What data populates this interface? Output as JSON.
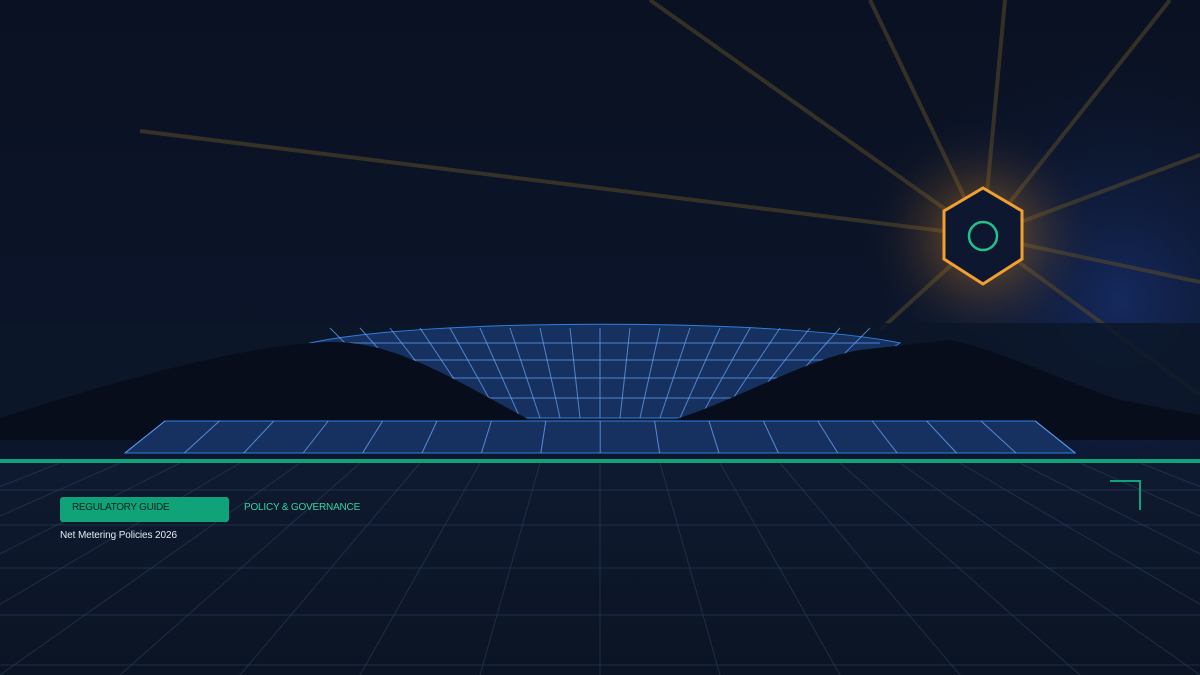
{
  "header": {
    "badge_label": "REGULATORY GUIDE",
    "category_label": "POLICY & GOVERNANCE",
    "subtitle": "Net Metering Policies 2026"
  },
  "icons": {
    "sun": "hexagon-sun-icon",
    "corner": "corner-bracket-icon"
  },
  "colors": {
    "background": "#0b1224",
    "accent": "#10a37a",
    "accent_text": "#34d3a0",
    "sun": "#f0a030",
    "grid": "#2f7fe0",
    "panel": "#16305f"
  }
}
